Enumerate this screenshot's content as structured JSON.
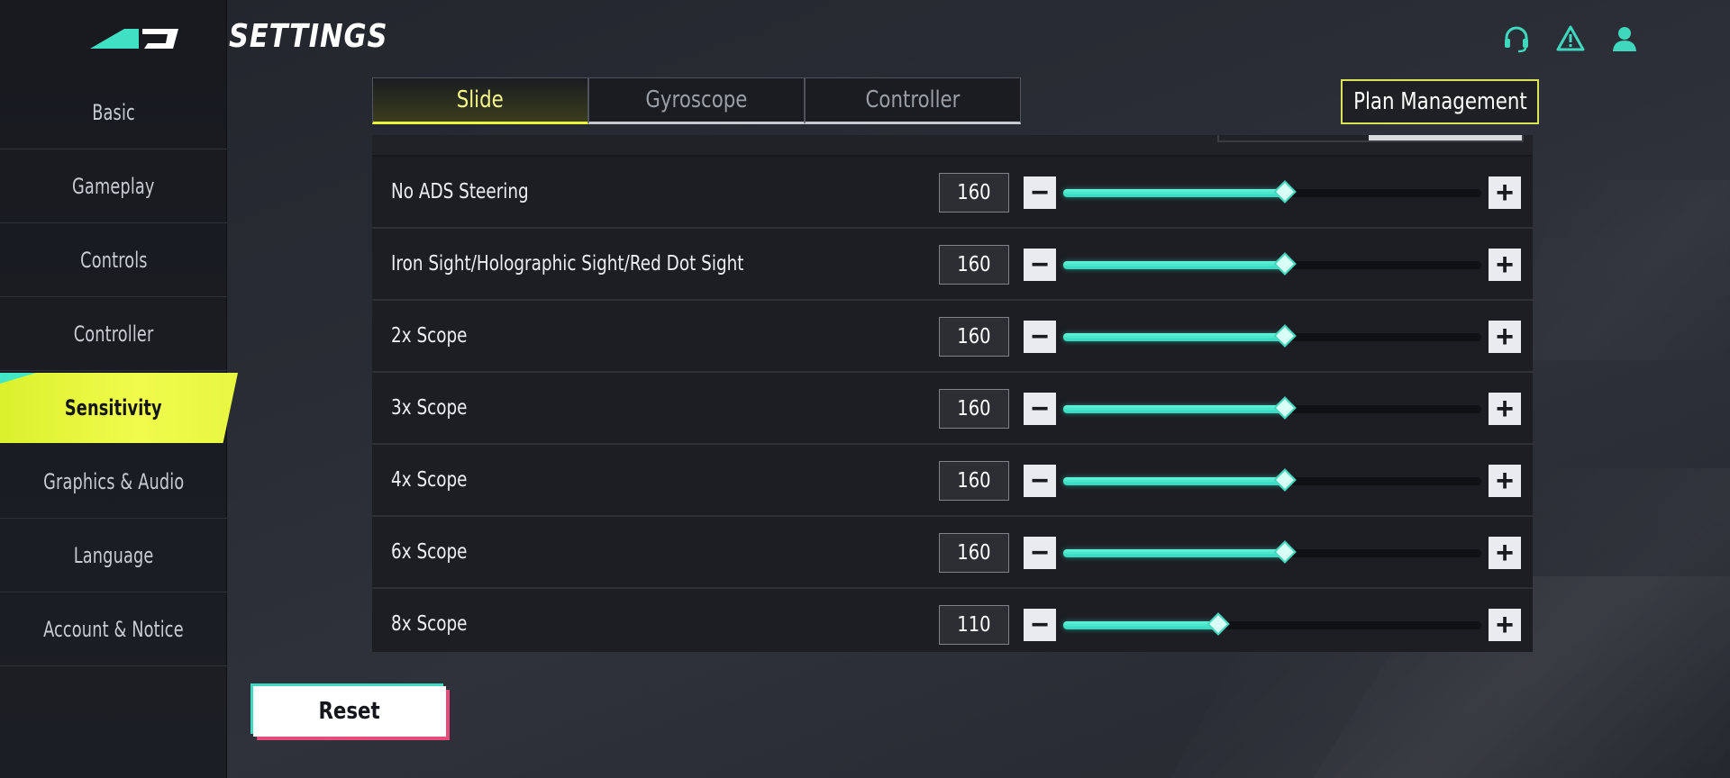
{
  "header": {
    "title": "SETTINGS",
    "icons": [
      "headset-icon",
      "warning-icon",
      "user-icon"
    ]
  },
  "sidebar": {
    "items": [
      {
        "label": "Basic"
      },
      {
        "label": "Gameplay"
      },
      {
        "label": "Controls"
      },
      {
        "label": "Controller"
      },
      {
        "label": "Sensitivity",
        "active": true
      },
      {
        "label": "Graphics & Audio"
      },
      {
        "label": "Language"
      },
      {
        "label": "Account & Notice"
      }
    ]
  },
  "tabs": [
    {
      "label": "Slide",
      "active": true
    },
    {
      "label": "Gyroscope"
    },
    {
      "label": "Controller"
    }
  ],
  "plan_button": "Plan Management",
  "slider_range": {
    "min": 0,
    "max": 300
  },
  "rows": [
    {
      "label": "No ADS Steering",
      "value": "160",
      "level": 0.53
    },
    {
      "label": "Iron Sight/Holographic Sight/Red Dot Sight",
      "value": "160",
      "level": 0.53
    },
    {
      "label": "2x Scope",
      "value": "160",
      "level": 0.53
    },
    {
      "label": "3x Scope",
      "value": "160",
      "level": 0.53
    },
    {
      "label": "4x Scope",
      "value": "160",
      "level": 0.53
    },
    {
      "label": "6x Scope",
      "value": "160",
      "level": 0.53
    },
    {
      "label": "8x Scope",
      "value": "110",
      "level": 0.37
    }
  ],
  "reset_button": "Reset",
  "colors": {
    "accent_yellow": "#e9f53b",
    "accent_teal": "#3fd8bd",
    "reset_pink": "#e84a7a"
  }
}
